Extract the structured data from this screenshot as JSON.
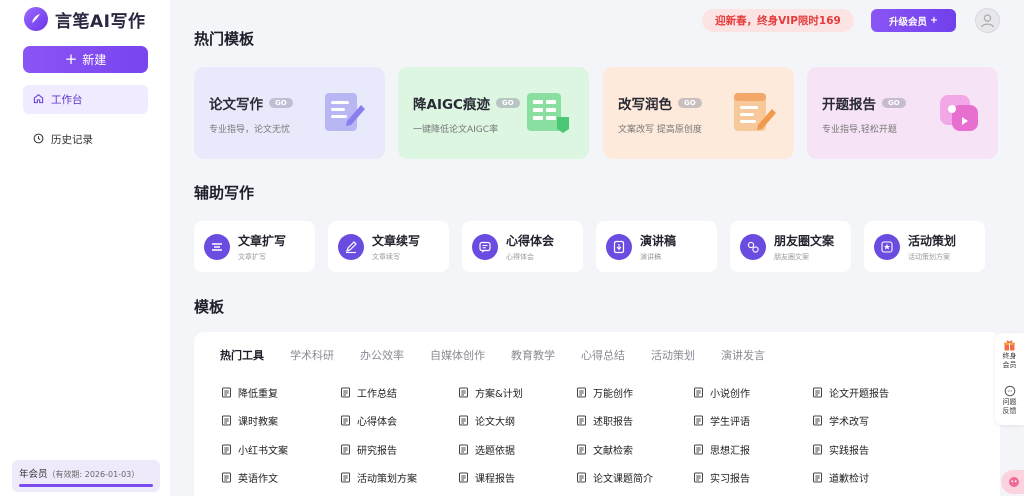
{
  "app": {
    "logo_text": "言笔AI写作"
  },
  "sidebar": {
    "new_label": "新建",
    "items": [
      {
        "label": "工作台",
        "icon": "home-icon",
        "active": true
      },
      {
        "label": "历史记录",
        "icon": "clock-icon",
        "active": false
      }
    ],
    "member": {
      "label": "年会员",
      "validity": "（有效期: 2026-01-03）",
      "progress": 1.0
    }
  },
  "header": {
    "promo": "迎新春，终身VIP限时169",
    "upgrade": "升级会员",
    "upgrade_suffix": "+"
  },
  "sections": {
    "hot": "热门模板",
    "assist": "辅助写作",
    "templates": "模板"
  },
  "hot_cards": [
    {
      "title": "论文写作",
      "badge": "GO",
      "sub": "专业指导，论文无忧",
      "color": "#e8eafc"
    },
    {
      "title": "降AIGC痕迹",
      "badge": "GO",
      "sub": "一键降低论文AIGC率",
      "color": "#dcf6e1"
    },
    {
      "title": "改写润色",
      "badge": "GO",
      "sub": "文案改写 提高原创度",
      "color": "#fdeadb"
    },
    {
      "title": "开题报告",
      "badge": "GO",
      "sub": "专业指导,轻松开题",
      "color": "#f7e3f6"
    }
  ],
  "assist_cards": [
    {
      "title": "文章扩写",
      "sub": "文章扩写",
      "icon": "expand-text-icon"
    },
    {
      "title": "文章续写",
      "sub": "文章续写",
      "icon": "pen-continue-icon"
    },
    {
      "title": "心得体会",
      "sub": "心得体会",
      "icon": "chat-bubble-icon"
    },
    {
      "title": "演讲稿",
      "sub": "演讲稿",
      "icon": "speech-doc-icon"
    },
    {
      "title": "朋友圈文案",
      "sub": "朋友圈文案",
      "icon": "moments-icon"
    },
    {
      "title": "活动策划",
      "sub": "活动策划方案",
      "icon": "star-badge-icon"
    }
  ],
  "template_tabs": [
    "热门工具",
    "学术科研",
    "办公效率",
    "自媒体创作",
    "教育教学",
    "心得总结",
    "活动策划",
    "演讲发言"
  ],
  "template_items": [
    [
      "降低重复",
      "工作总结",
      "方案&计划",
      "万能创作",
      "小说创作",
      "论文开题报告"
    ],
    [
      "课时教案",
      "心得体会",
      "论文大纲",
      "述职报告",
      "学生评语",
      "学术改写"
    ],
    [
      "小红书文案",
      "研究报告",
      "选题依据",
      "文献检索",
      "思想汇报",
      "实践报告"
    ],
    [
      "英语作文",
      "活动策划方案",
      "课程报告",
      "论文课题简介",
      "实习报告",
      "道歉检讨"
    ]
  ],
  "float": {
    "vip": "终身会员",
    "feedback": "问题反馈"
  },
  "colors": {
    "accent": "#7b4bef",
    "promo_red": "#e53b3b"
  }
}
